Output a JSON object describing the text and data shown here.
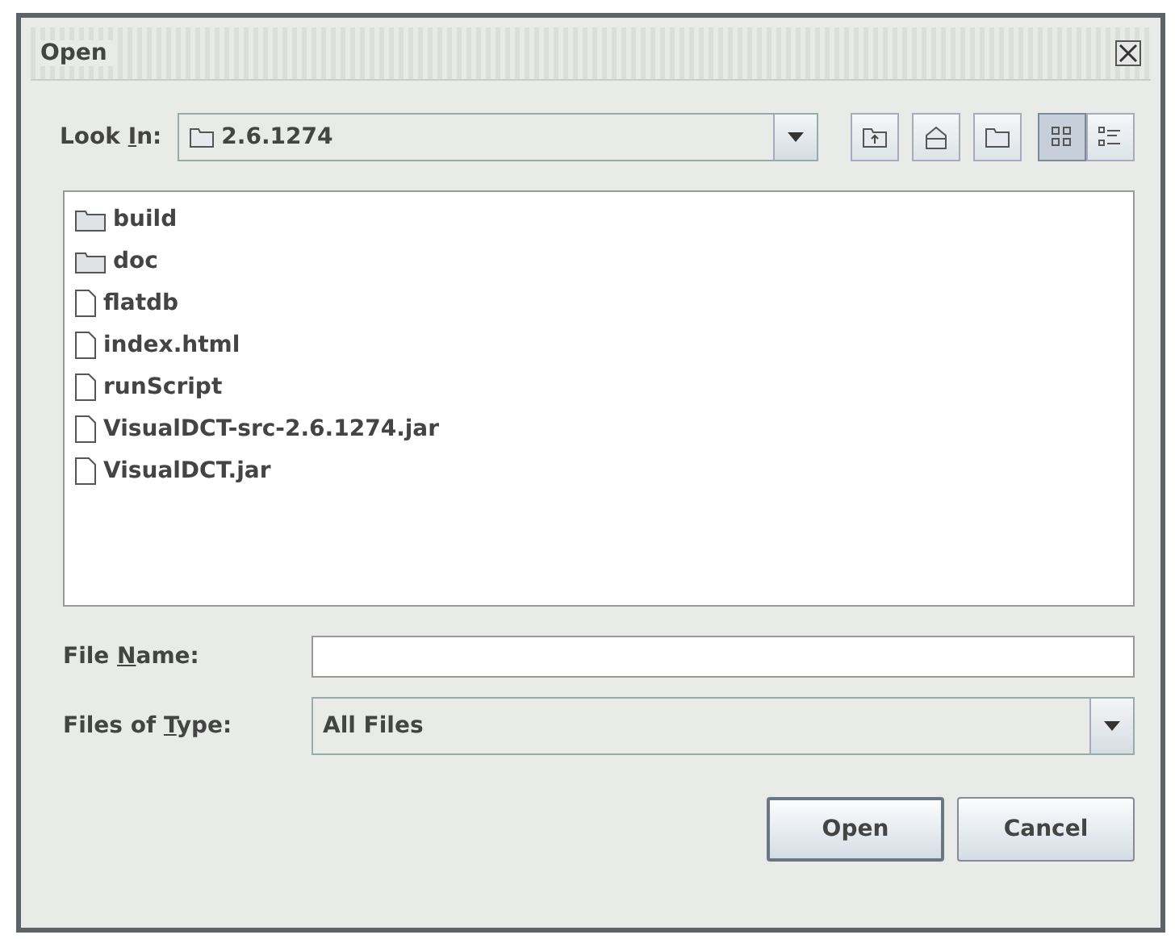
{
  "window": {
    "title": "Open"
  },
  "look_in": {
    "label": [
      "Look ",
      "I",
      "n:"
    ],
    "value": "2.6.1274"
  },
  "toolbar": [
    {
      "kind": "up",
      "selected": false
    },
    {
      "kind": "home",
      "selected": false
    },
    {
      "kind": "new-folder",
      "selected": false
    },
    {
      "kind": "list",
      "selected": true
    },
    {
      "kind": "details",
      "selected": false
    }
  ],
  "files": [
    {
      "name": "build",
      "kind": "folder"
    },
    {
      "name": "doc",
      "kind": "folder"
    },
    {
      "name": "flatdb",
      "kind": "file"
    },
    {
      "name": "index.html",
      "kind": "file"
    },
    {
      "name": "runScript",
      "kind": "file"
    },
    {
      "name": "VisualDCT-src-2.6.1274.jar",
      "kind": "file"
    },
    {
      "name": "VisualDCT.jar",
      "kind": "file"
    }
  ],
  "file_name": {
    "label": [
      "File ",
      "N",
      "ame:"
    ]
  },
  "files_of_type": {
    "label": [
      "Files of ",
      "T",
      "ype:"
    ],
    "value": "All Files"
  },
  "buttons": [
    "Open",
    "Cancel"
  ]
}
